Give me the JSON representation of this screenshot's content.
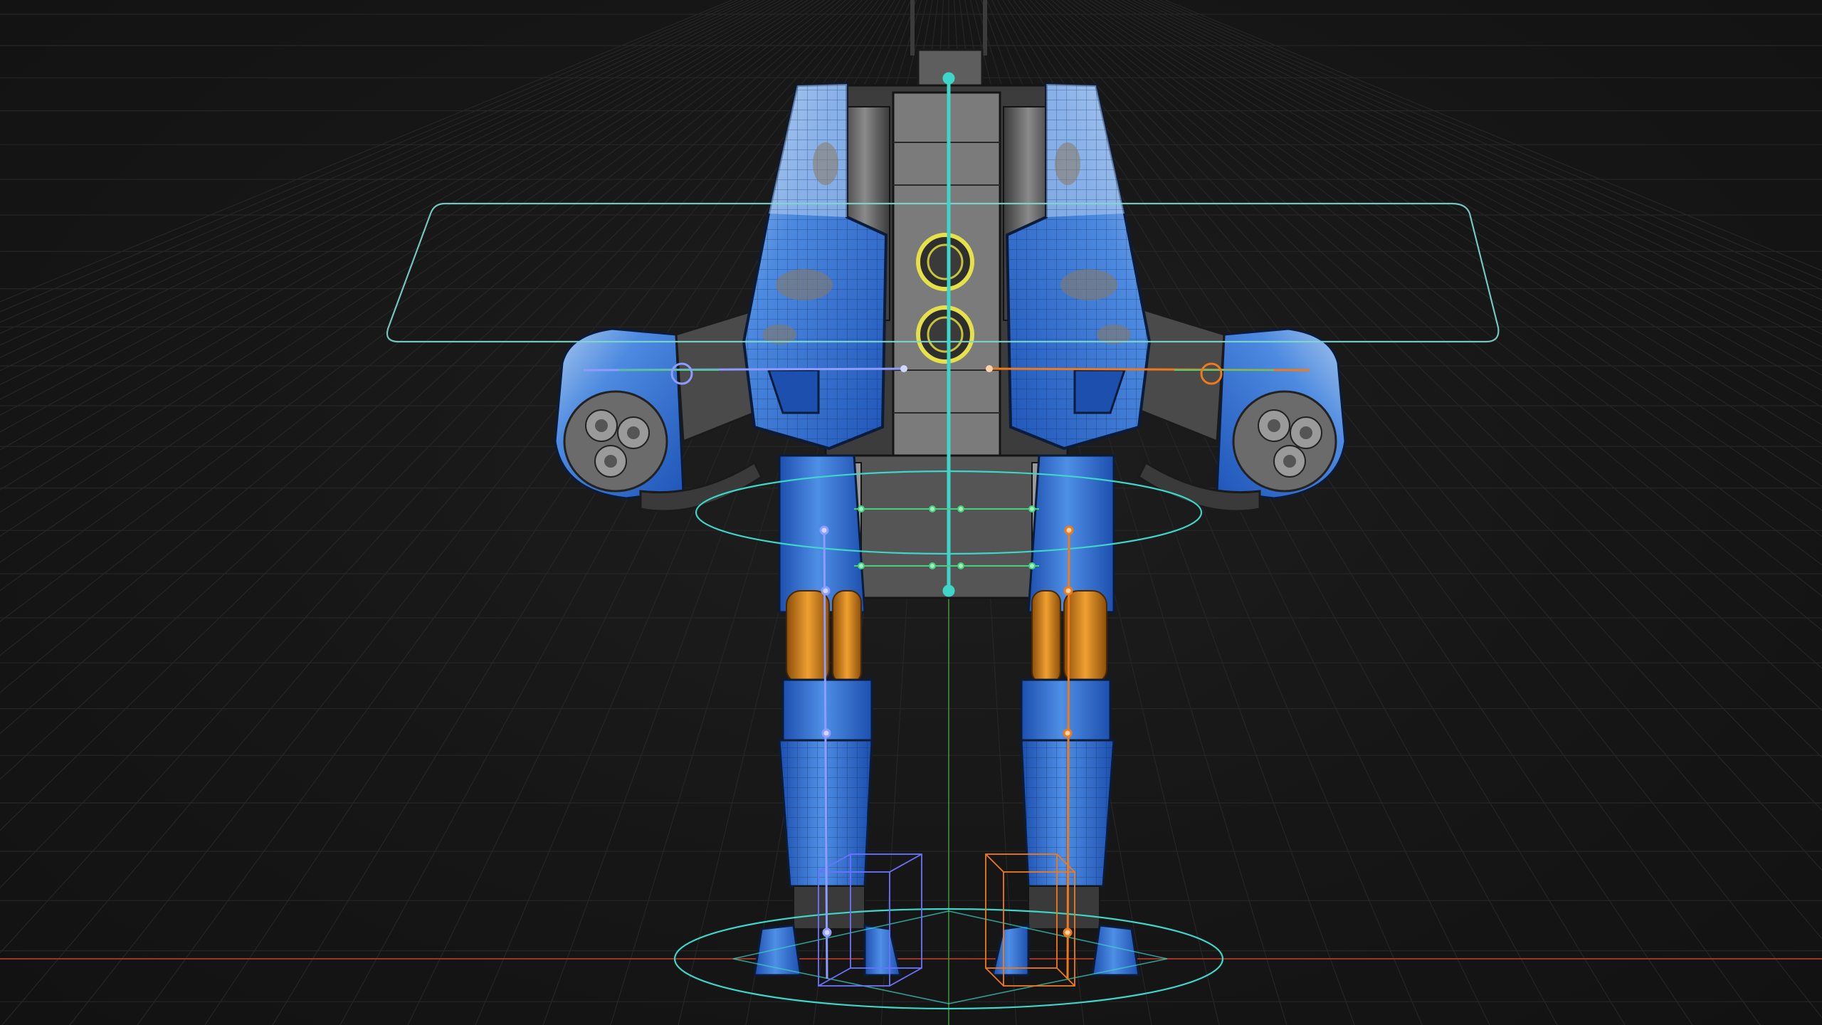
{
  "viewport": {
    "mode": "3D rig view",
    "background": "#161616"
  },
  "colors": {
    "grid": "#2a2a2a",
    "x_axis": "#b03a2e",
    "y_axis": "#3f8f3a",
    "armor_blue": "#2f6fd6",
    "armor_light": "#9ec0ea",
    "mech_grey": "#5a5a5a",
    "wire": "#1a1a1a",
    "rig_cyan": "#3dd6c8",
    "rig_blue": "#7e8cff",
    "rig_orange": "#f07a1a",
    "rig_green": "#44d07a",
    "hydraulic_orange": "#e08a1a",
    "emissive_yellow": "#e6e04a"
  },
  "rig": {
    "controls": [
      "torso-control-plane",
      "hip-control-ring",
      "root-control-ring",
      "left-foot-ik-box",
      "right-foot-ik-box"
    ],
    "chains": [
      "spine-bone",
      "left-leg-chain",
      "right-leg-chain",
      "left-arm-chain",
      "right-arm-chain"
    ]
  },
  "icons": [
    "axis-x-line",
    "axis-y-line"
  ]
}
